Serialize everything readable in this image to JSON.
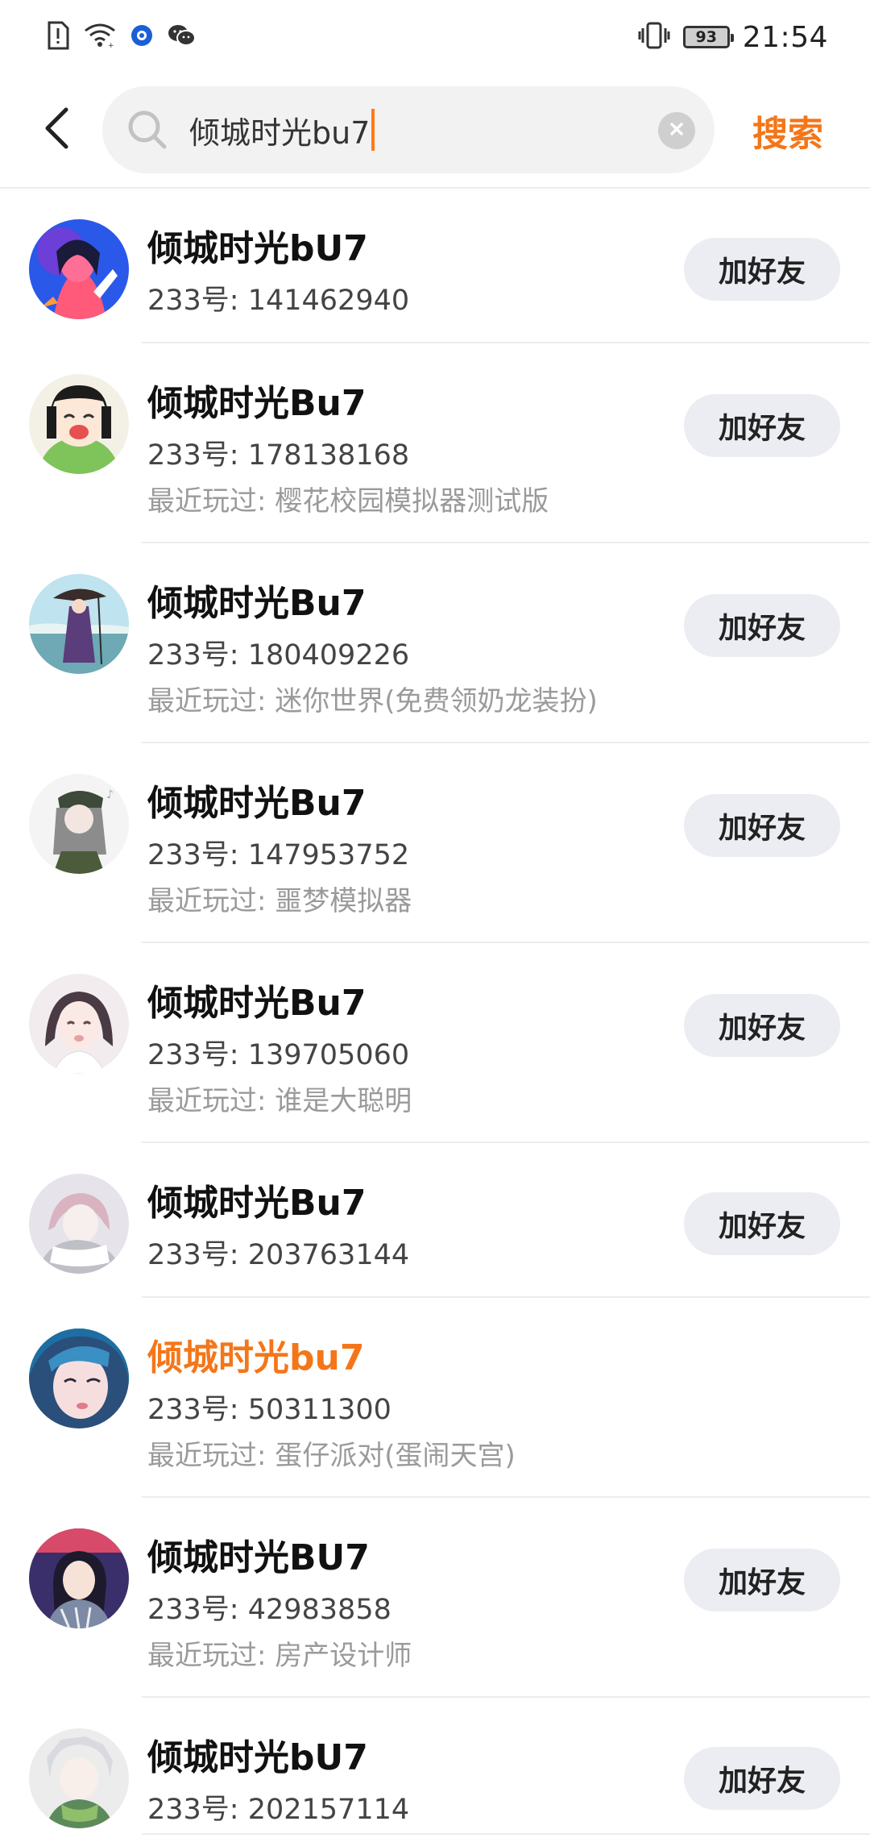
{
  "status_bar": {
    "time": "21:54",
    "battery": "93",
    "left_icons": [
      "sim-alert-icon",
      "wifi-icon",
      "app-notification-icon",
      "wechat-icon"
    ],
    "right_icons": [
      "vibrate-icon",
      "battery-icon"
    ]
  },
  "header": {
    "back_icon": "back-arrow-icon",
    "search_query": "倾城时光bu7",
    "search_icon": "search-icon",
    "clear_icon": "clear-icon",
    "search_button_label": "搜索",
    "accent_color": "#f47619"
  },
  "results": [
    {
      "nickname": "倾城时光bU7",
      "uid": "233号: 141462940",
      "recent": "",
      "action": "加好友"
    },
    {
      "nickname": "倾城时光Bu7",
      "uid": "233号: 178138168",
      "recent": "最近玩过: 樱花校园模拟器测试版",
      "action": "加好友"
    },
    {
      "nickname": "倾城时光Bu7",
      "uid": "233号: 180409226",
      "recent": "最近玩过: 迷你世界(免费领奶龙装扮)",
      "action": "加好友"
    },
    {
      "nickname": "倾城时光Bu7",
      "uid": "233号: 147953752",
      "recent": "最近玩过: 噩梦模拟器",
      "action": "加好友"
    },
    {
      "nickname": "倾城时光Bu7",
      "uid": "233号: 139705060",
      "recent": "最近玩过: 谁是大聪明",
      "action": "加好友"
    },
    {
      "nickname": "倾城时光Bu7",
      "uid": "233号: 203763144",
      "recent": "",
      "action": "加好友"
    },
    {
      "nickname": "倾城时光bu7",
      "uid": "233号: 50311300",
      "recent": "最近玩过: 蛋仔派对(蛋闹天宫)",
      "action": ""
    },
    {
      "nickname": "倾城时光BU7",
      "uid": "233号: 42983858",
      "recent": "最近玩过: 房产设计师",
      "action": "加好友"
    },
    {
      "nickname": "倾城时光bU7",
      "uid": "233号: 202157114",
      "recent": "",
      "action": "加好友"
    }
  ]
}
